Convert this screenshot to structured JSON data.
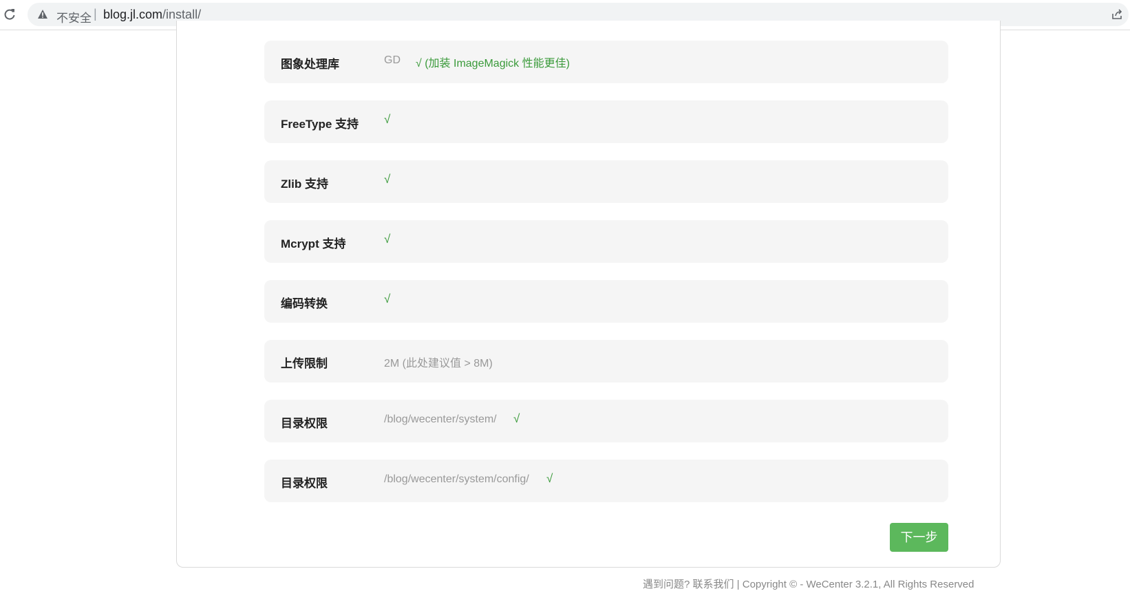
{
  "browser": {
    "security_label": "不安全",
    "separator": "|",
    "url_host": "blog.jl.com",
    "url_path": "/install/"
  },
  "checks": [
    {
      "label": "图象处理库",
      "value": "GD",
      "status": "√ (加装 ImageMagick 性能更佳)"
    },
    {
      "label": "FreeType 支持",
      "value": "",
      "status": "√"
    },
    {
      "label": "Zlib 支持",
      "value": "",
      "status": "√"
    },
    {
      "label": "Mcrypt 支持",
      "value": "",
      "status": "√"
    },
    {
      "label": "编码转换",
      "value": "",
      "status": "√"
    },
    {
      "label": "上传限制",
      "value": "2M (此处建议值 > 8M)",
      "status": ""
    },
    {
      "label": "目录权限",
      "value": "/blog/wecenter/system/",
      "status": "√"
    },
    {
      "label": "目录权限",
      "value": "/blog/wecenter/system/config/",
      "status": "√"
    }
  ],
  "next_button_label": "下一步",
  "footer_text": "遇到问题? 联系我们 | Copyright © - WeCenter 3.2.1, All Rights Reserved",
  "colors": {
    "accent_green": "#5cb85c",
    "check_green": "#3a9a3a",
    "row_bg": "#f5f5f5"
  }
}
